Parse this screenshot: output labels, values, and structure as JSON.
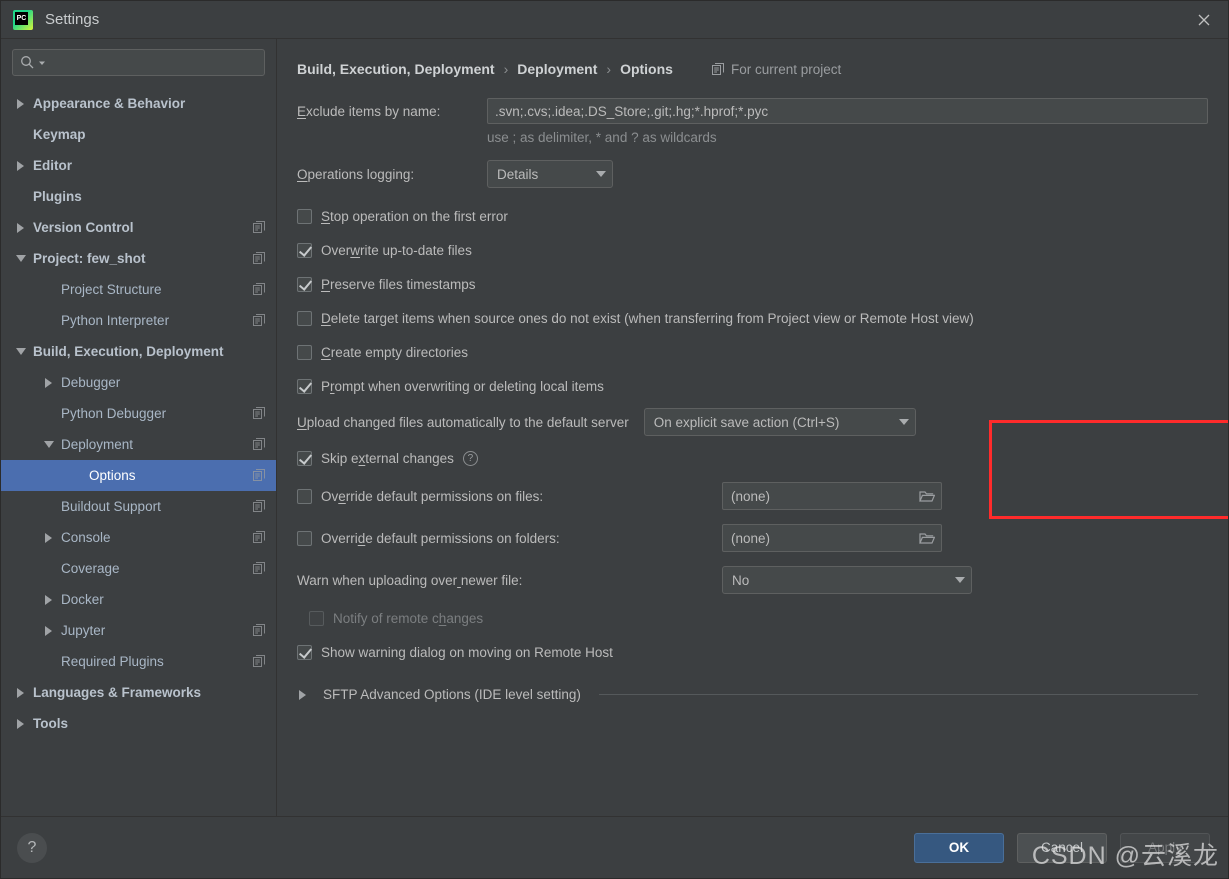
{
  "window": {
    "title": "Settings",
    "logo_label": "PC",
    "close_icon": "close-icon"
  },
  "sidebar": {
    "search_placeholder": "",
    "search_value": "",
    "items": [
      {
        "label": "Appearance & Behavior",
        "depth": 0,
        "arrow": "collapsed",
        "bold": true,
        "badge": false,
        "selected": false
      },
      {
        "label": "Keymap",
        "depth": 0,
        "arrow": "none",
        "bold": true,
        "badge": false,
        "selected": false
      },
      {
        "label": "Editor",
        "depth": 0,
        "arrow": "collapsed",
        "bold": true,
        "badge": false,
        "selected": false
      },
      {
        "label": "Plugins",
        "depth": 0,
        "arrow": "none",
        "bold": true,
        "badge": false,
        "selected": false
      },
      {
        "label": "Version Control",
        "depth": 0,
        "arrow": "collapsed",
        "bold": true,
        "badge": true,
        "selected": false
      },
      {
        "label": "Project: few_shot",
        "depth": 0,
        "arrow": "expanded",
        "bold": true,
        "badge": true,
        "selected": false
      },
      {
        "label": "Project Structure",
        "depth": 1,
        "arrow": "none",
        "bold": false,
        "badge": true,
        "selected": false
      },
      {
        "label": "Python Interpreter",
        "depth": 1,
        "arrow": "none",
        "bold": false,
        "badge": true,
        "selected": false
      },
      {
        "label": "Build, Execution, Deployment",
        "depth": 0,
        "arrow": "expanded",
        "bold": true,
        "badge": false,
        "selected": false
      },
      {
        "label": "Debugger",
        "depth": 1,
        "arrow": "collapsed",
        "bold": false,
        "badge": false,
        "selected": false
      },
      {
        "label": "Python Debugger",
        "depth": 1,
        "arrow": "none",
        "bold": false,
        "badge": true,
        "selected": false
      },
      {
        "label": "Deployment",
        "depth": 1,
        "arrow": "expanded",
        "bold": false,
        "badge": true,
        "selected": false
      },
      {
        "label": "Options",
        "depth": 2,
        "arrow": "none",
        "bold": false,
        "badge": true,
        "selected": true
      },
      {
        "label": "Buildout Support",
        "depth": 1,
        "arrow": "none",
        "bold": false,
        "badge": true,
        "selected": false
      },
      {
        "label": "Console",
        "depth": 1,
        "arrow": "collapsed",
        "bold": false,
        "badge": true,
        "selected": false
      },
      {
        "label": "Coverage",
        "depth": 1,
        "arrow": "none",
        "bold": false,
        "badge": true,
        "selected": false
      },
      {
        "label": "Docker",
        "depth": 1,
        "arrow": "collapsed",
        "bold": false,
        "badge": false,
        "selected": false
      },
      {
        "label": "Jupyter",
        "depth": 1,
        "arrow": "collapsed",
        "bold": false,
        "badge": true,
        "selected": false
      },
      {
        "label": "Required Plugins",
        "depth": 1,
        "arrow": "none",
        "bold": false,
        "badge": true,
        "selected": false
      },
      {
        "label": "Languages & Frameworks",
        "depth": 0,
        "arrow": "collapsed",
        "bold": true,
        "badge": false,
        "selected": false
      },
      {
        "label": "Tools",
        "depth": 0,
        "arrow": "collapsed",
        "bold": true,
        "badge": false,
        "selected": false
      }
    ]
  },
  "main": {
    "breadcrumb": {
      "crumb1": "Build, Execution, Deployment",
      "sep1": "›",
      "crumb2": "Deployment",
      "sep2": "›",
      "crumb3": "Options",
      "scope_label": "For current project"
    },
    "exclude": {
      "label": "Exclude items by name:",
      "value": ".svn;.cvs;.idea;.DS_Store;.git;.hg;*.hprof;*.pyc",
      "placeholder": "",
      "hint": "use ; as delimiter, * and ? as wildcards"
    },
    "logging": {
      "label": "Operations logging:",
      "value": "Details"
    },
    "checkboxes": [
      {
        "label": "Stop operation on the first error",
        "checked": false,
        "disabled": false,
        "indent": false
      },
      {
        "label": "Overwrite up-to-date files",
        "checked": true,
        "disabled": false,
        "indent": false
      },
      {
        "label": "Preserve files timestamps",
        "checked": true,
        "disabled": false,
        "indent": false
      },
      {
        "label": "Delete target items when source ones do not exist (when transferring from Project view or Remote Host view)",
        "checked": false,
        "disabled": false,
        "indent": false
      },
      {
        "label": "Create empty directories",
        "checked": false,
        "disabled": false,
        "indent": false
      },
      {
        "label": "Prompt when overwriting or deleting local items",
        "checked": true,
        "disabled": false,
        "indent": false
      }
    ],
    "upload": {
      "label": "Upload changed files automatically to the default server",
      "value": "On explicit save action (Ctrl+S)"
    },
    "skip_external": {
      "label": "Skip external changes",
      "checked": true,
      "help_icon": "help-circle-icon"
    },
    "permissions": [
      {
        "label": "Override default permissions on files:",
        "checked": false,
        "value": "(none)"
      },
      {
        "label": "Override default permissions on folders:",
        "checked": false,
        "value": "(none)"
      }
    ],
    "warn": {
      "label": "Warn when uploading over newer file:",
      "value": "No"
    },
    "notify": {
      "label": "Notify of remote changes",
      "checked": false,
      "disabled": true
    },
    "show_warning": {
      "label": "Show warning dialog on moving on Remote Host",
      "checked": true
    },
    "sftp": {
      "label": "SFTP Advanced Options (IDE level setting)",
      "expanded": false
    },
    "annotation": {
      "color": "#ff2b2b"
    }
  },
  "footer": {
    "help_label": "?",
    "ok_label": "OK",
    "cancel_label": "Cancel",
    "apply_label": "Apply"
  },
  "watermark": {
    "text": "CSDN @云溪龙"
  },
  "colors": {
    "background": "#3c3f41",
    "selection": "#4b6eaf",
    "primary_button": "#365880",
    "annotation_red": "#ff2b2b",
    "text": "#bbbbbb",
    "tree_text": "#a9b7c6"
  }
}
